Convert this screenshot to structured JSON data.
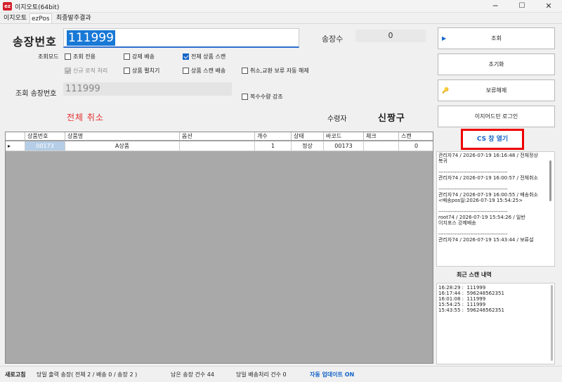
{
  "window": {
    "title": "이지오토(64bit)",
    "icon": "ez",
    "minimize": "─",
    "maximize": "☐",
    "close": "✕"
  },
  "menu": [
    "이지오토",
    "ezPos",
    "최종발주결과"
  ],
  "invoice": {
    "label": "송장번호",
    "value": "111999",
    "count_label": "송장수",
    "count_value": "0"
  },
  "mode": {
    "label": "조회모드",
    "options": [
      {
        "label": "조회 전용",
        "checked": false,
        "disabled": false
      },
      {
        "label": "강제 배송",
        "checked": false,
        "disabled": false
      },
      {
        "label": "전체 상품 스캔",
        "checked": true,
        "disabled": false
      },
      {
        "label": "신규 로직 처리",
        "checked": true,
        "disabled": true
      },
      {
        "label": "상품 펼치기",
        "checked": false,
        "disabled": false
      },
      {
        "label": "상품 스캔 배송",
        "checked": false,
        "disabled": false
      },
      {
        "label": "취소,교환 보류 자동 해제",
        "checked": false,
        "disabled": false
      },
      {
        "label": "복수수량 강조",
        "checked": false,
        "disabled": false
      }
    ]
  },
  "lookup": {
    "label": "조회 송장번호",
    "value": "111999"
  },
  "cancel_all": "전체 취소",
  "recipient": {
    "label": "수령자",
    "name": "신짱구"
  },
  "grid": {
    "columns": [
      "상품번호",
      "상품명",
      "옵션",
      "개수",
      "상태",
      "바코드",
      "체크",
      "스캔"
    ],
    "rows": [
      {
        "indicator": "▸",
        "cells": [
          "00173",
          "A상품",
          "",
          "1",
          "정상",
          "00173",
          "",
          "0"
        ]
      }
    ]
  },
  "buttons": {
    "search": "조회",
    "reset": "초기화",
    "release_hold": "보류해제",
    "easyadmin_login": "이지어드민 로그인",
    "cs_open": "CS 창 열기"
  },
  "history": "관리자74 / 2026-07-19 16:16:48 / 전체정상복귀\n\n---------------------------------------\n관리자74 / 2026-07-19 16:00:57 / 전체취소\n\n---------------------------------------\n관리자74 / 2026-07-19 16:00:55 / 배송취소\n<배송pos일:2026-07-19 15:54:25>\n\n---------------------------------------\nroot74 / 2026-07-19 15:54:26 / 일반\n이지포스 강제배송\n\n---------------------------------------\n관리자74 / 2026-07-19 15:43:44 / 보류설",
  "recent_scan": {
    "title": "최근 스캔 내역",
    "items": "16:28:29 :  111999\n16:17:44 :  596248562351\n16:01:08 :  111999\n15:54:25 :  111999\n15:43:55 :  596248562351"
  },
  "status": {
    "refresh": "새로고침",
    "today_output": "당일 출력 송장( 전체 2 / 배송 0 / 송장 2 )",
    "remaining": "남은 송장 건수  44",
    "today_shipped": "당일 배송처리 건수  0",
    "auto_update": "자동 업데이트 ON"
  },
  "colors": {
    "accent": "#1979d6",
    "cancel": "#e53030",
    "cs_border": "#ee0000",
    "update": "#1565c8"
  }
}
